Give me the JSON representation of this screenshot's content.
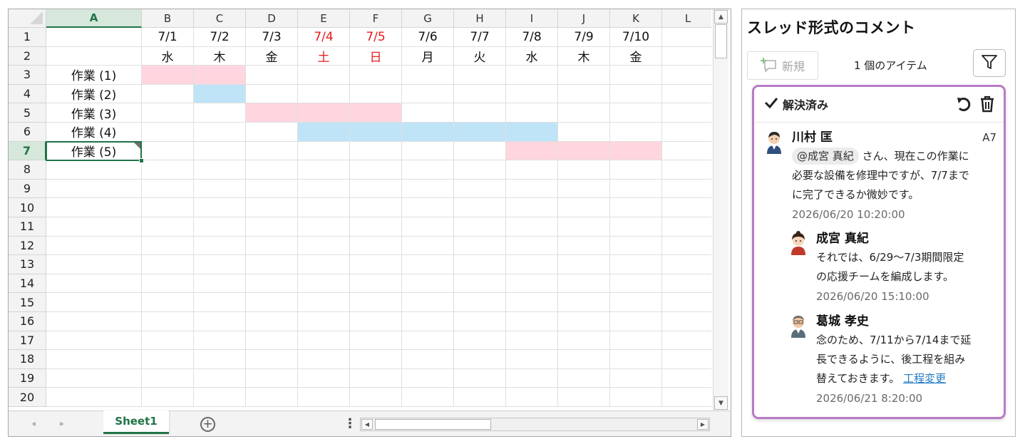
{
  "sheet": {
    "columns": [
      "A",
      "B",
      "C",
      "D",
      "E",
      "F",
      "G",
      "H",
      "I",
      "J",
      "K",
      "L"
    ],
    "active_column": "A",
    "rows": [
      "1",
      "2",
      "3",
      "4",
      "5",
      "6",
      "7",
      "8",
      "9",
      "10",
      "11",
      "12",
      "13",
      "14",
      "15",
      "16",
      "17",
      "18",
      "19",
      "20"
    ],
    "active_row": "7",
    "dates": [
      "7/1",
      "7/2",
      "7/3",
      "7/4",
      "7/5",
      "7/6",
      "7/7",
      "7/8",
      "7/9",
      "7/10"
    ],
    "weekdays": [
      "水",
      "木",
      "金",
      "土",
      "日",
      "月",
      "火",
      "水",
      "木",
      "金"
    ],
    "holiday_color": "#e81a1a",
    "tasks": [
      "作業 (1)",
      "作業 (2)",
      "作業 (3)",
      "作業 (4)",
      "作業 (5)"
    ],
    "task_bar_colors": [
      "pink",
      "blue",
      "pink",
      "blue",
      "pink"
    ],
    "selected_cell": "A7",
    "sheet_tab": "Sheet1",
    "add_sheet_icon": "plus-circle-icon",
    "accent_color": "#217346"
  },
  "comments": {
    "title": "スレッド形式のコメント",
    "new_label": "新規",
    "item_count": "1 個のアイテム",
    "filter_icon": "filter-icon",
    "thread": {
      "status": "解決済み",
      "cell_ref": "A7",
      "border_color": "#b77cc4",
      "main": {
        "author": "川村 匡",
        "mention": "@成宮 真紀",
        "lines": [
          "さん、現在この作業に",
          "必要な設備を修理中ですが、7/7まで",
          "に完了できるか微妙です。"
        ],
        "time": "2026/06/20 10:20:00"
      },
      "replies": [
        {
          "author": "成宮 真紀",
          "lines": [
            "それでは、6/29～7/3期間限定",
            "の応援チームを編成します。"
          ],
          "time": "2026/06/20 15:10:00"
        },
        {
          "author": "葛城 孝史",
          "lines": [
            "念のため、7/11から7/14まで延",
            "長できるように、後工程を組み",
            "替えておきます。"
          ],
          "link": "工程変更",
          "time": "2026/06/21 8:20:00"
        }
      ]
    }
  }
}
